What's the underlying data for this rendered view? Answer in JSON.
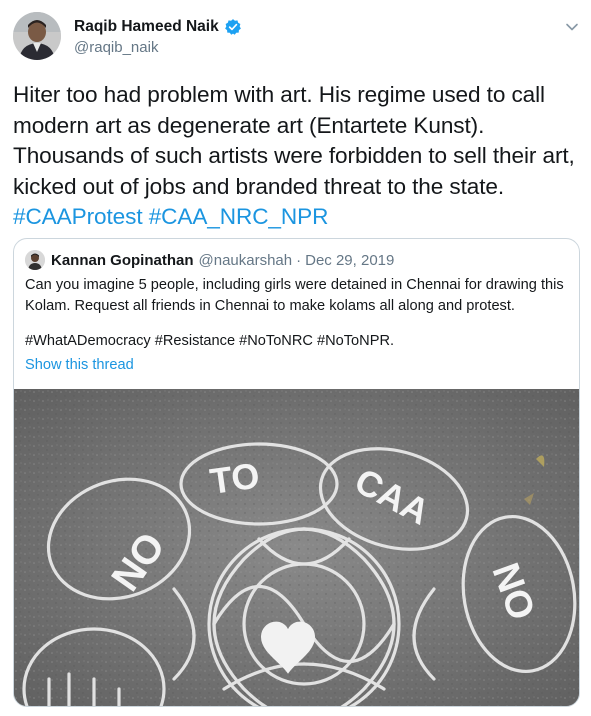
{
  "tweet": {
    "author": {
      "name": "Raqib Hameed Naik",
      "handle": "@raqib_naik",
      "verified_icon": "verified-badge-icon"
    },
    "menu_icon": "chevron-down-icon",
    "body": {
      "text": "Hiter too had problem with art. His regime used to call modern art as degenerate art (Entartete Kunst). Thousands of such artists were forbidden to sell their art, kicked out of jobs and branded threat to the state.",
      "hashtags": [
        "#CAAProtest",
        "#CAA_NRC_NPR"
      ]
    }
  },
  "quote": {
    "author_name": "Kannan Gopinathan",
    "author_handle": "@naukarshah",
    "separator": "·",
    "date": "Dec 29, 2019",
    "text": "Can you imagine 5 people, including girls were detained in Chennai for drawing this Kolam. Request all friends in Chennai to make kolams all along and protest.",
    "hashtags": "#WhatADemocracy #Resistance #NoToNRC #NoToNPR.",
    "show_thread": "Show this thread",
    "image_text": {
      "word_no_left": "NO",
      "word_to": "TO",
      "word_caa": "CAA",
      "word_no_right": "NO"
    }
  },
  "colors": {
    "link_blue": "#1b95e0",
    "secondary_text": "#657786",
    "border": "#ccd6dd",
    "verified_blue": "#1da1f2"
  }
}
